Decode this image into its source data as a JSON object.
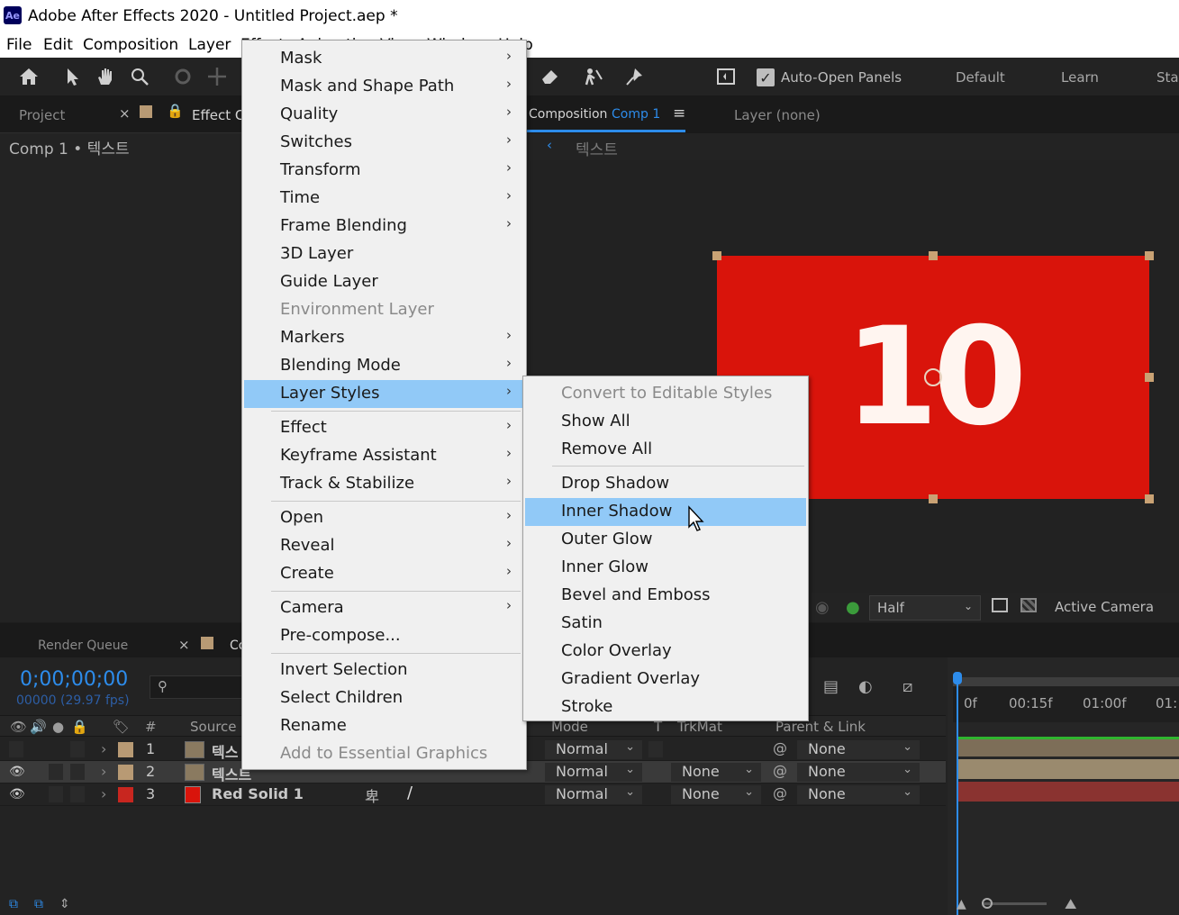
{
  "window": {
    "title": "Adobe After Effects 2020 - Untitled Project.aep *",
    "app_icon": "Ae"
  },
  "menubar": [
    "File",
    "Edit",
    "Composition",
    "Layer",
    "Effect",
    "Animation",
    "View",
    "Window",
    "Help"
  ],
  "toolbar": {
    "auto_open_panels": "Auto-Open Panels",
    "workspaces": [
      "Default",
      "Learn",
      "Sta"
    ]
  },
  "project_panel": {
    "tab_project": "Project",
    "tab_effect_controls": "Effect Co",
    "breadcrumb": "Comp 1 • 텍스트"
  },
  "composition_panel": {
    "tab_prefix": "Composition",
    "tab_comp": "Comp 1",
    "layer_tab": "Layer (none)",
    "breadcrumb": "텍스트",
    "canvas_text": "10",
    "canvas_color": "#d9140b",
    "resolution": "Half",
    "camera": "Active Camera"
  },
  "timeline": {
    "tab_render_queue": "Render Queue",
    "tab_comp": "Co",
    "timecode": "0;00;00;00",
    "fps": "00000 (29.97 fps)",
    "headers": {
      "num": "#",
      "source": "Source",
      "mode": "Mode",
      "t": "T",
      "trkmat": "TrkMat",
      "parent": "Parent & Link"
    },
    "ruler": [
      "0f",
      "00:15f",
      "01:00f",
      "01:"
    ],
    "layers": [
      {
        "num": "1",
        "name": "텍스",
        "mode": "Normal",
        "trkmat": "",
        "parent": "None",
        "color": "#b89a74"
      },
      {
        "num": "2",
        "name": "텍스트",
        "mode": "Normal",
        "trkmat": "None",
        "parent": "None",
        "color": "#b89a74"
      },
      {
        "num": "3",
        "name": "Red Solid 1",
        "mode": "Normal",
        "trkmat": "None",
        "parent": "None",
        "color": "#c8261f"
      }
    ]
  },
  "layer_menu": {
    "items": [
      {
        "label": "Mask",
        "submenu": true
      },
      {
        "label": "Mask and Shape Path",
        "submenu": true
      },
      {
        "label": "Quality",
        "submenu": true
      },
      {
        "label": "Switches",
        "submenu": true
      },
      {
        "label": "Transform",
        "submenu": true
      },
      {
        "label": "Time",
        "submenu": true
      },
      {
        "label": "Frame Blending",
        "submenu": true
      },
      {
        "label": "3D Layer"
      },
      {
        "label": "Guide Layer"
      },
      {
        "label": "Environment Layer",
        "disabled": true
      },
      {
        "label": "Markers",
        "submenu": true
      },
      {
        "label": "Blending Mode",
        "submenu": true
      },
      {
        "label": "Layer Styles",
        "submenu": true,
        "highlighted": true
      },
      {
        "label": "Effect",
        "submenu": true
      },
      {
        "label": "Keyframe Assistant",
        "submenu": true
      },
      {
        "label": "Track & Stabilize",
        "submenu": true
      },
      {
        "label": "Open",
        "submenu": true
      },
      {
        "label": "Reveal",
        "submenu": true
      },
      {
        "label": "Create",
        "submenu": true
      },
      {
        "label": "Camera",
        "submenu": true
      },
      {
        "label": "Pre-compose..."
      },
      {
        "label": "Invert Selection"
      },
      {
        "label": "Select Children"
      },
      {
        "label": "Rename"
      },
      {
        "label": "Add to Essential Graphics",
        "disabled": true
      }
    ]
  },
  "layer_styles_menu": {
    "items": [
      {
        "label": "Convert to Editable Styles",
        "disabled": true
      },
      {
        "label": "Show All"
      },
      {
        "label": "Remove All"
      },
      {
        "label": "Drop Shadow"
      },
      {
        "label": "Inner Shadow",
        "highlighted": true
      },
      {
        "label": "Outer Glow"
      },
      {
        "label": "Inner Glow"
      },
      {
        "label": "Bevel and Emboss"
      },
      {
        "label": "Satin"
      },
      {
        "label": "Color Overlay"
      },
      {
        "label": "Gradient Overlay"
      },
      {
        "label": "Stroke"
      }
    ]
  }
}
